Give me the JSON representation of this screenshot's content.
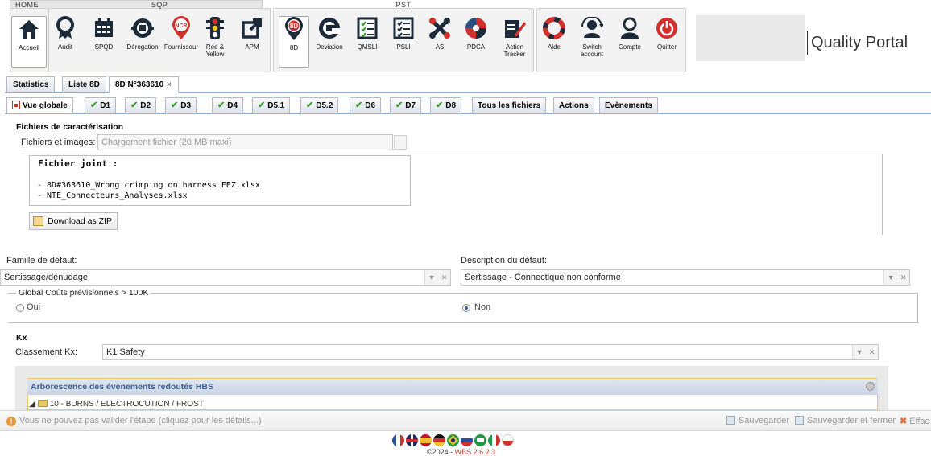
{
  "ribbon": {
    "groups": [
      {
        "title": "HOME"
      },
      {
        "title": "SQP"
      },
      {
        "title": "PST"
      },
      {
        "title": ""
      }
    ],
    "buttons": [
      {
        "label": "Accueil",
        "icon": "home-icon"
      },
      {
        "label": "Audit",
        "icon": "badge-icon"
      },
      {
        "label": "SPQD",
        "icon": "calendar-icon"
      },
      {
        "label": "Dérogation",
        "icon": "derogation-icon"
      },
      {
        "label": "Fournisseur",
        "icon": "ncr-icon"
      },
      {
        "label": "Red &\nYellow",
        "icon": "traffic-light-icon"
      },
      {
        "label": "APM",
        "icon": "external-arrow-icon"
      },
      {
        "label": "8D",
        "icon": "8d-icon"
      },
      {
        "label": "Deviation",
        "icon": "deviation-icon"
      },
      {
        "label": "QMSLI",
        "icon": "checklist-icon"
      },
      {
        "label": "PSLI",
        "icon": "checklist-icon"
      },
      {
        "label": "AS",
        "icon": "tools-icon"
      },
      {
        "label": "PDCA",
        "icon": "pdca-icon"
      },
      {
        "label": "Action\nTracker",
        "icon": "action-tracker-icon"
      },
      {
        "label": "Aide",
        "icon": "lifebuoy-icon"
      },
      {
        "label": "Switch\naccount",
        "icon": "switch-user-icon"
      },
      {
        "label": "Compte",
        "icon": "user-icon"
      },
      {
        "label": "Quitter",
        "icon": "power-icon"
      }
    ],
    "portal_title": "Quality Portal"
  },
  "top_tabs": [
    {
      "label": "Statistics"
    },
    {
      "label": "Liste 8D"
    },
    {
      "label": "8D N°363610"
    }
  ],
  "sub_tabs": [
    {
      "label": "Vue globale"
    },
    {
      "label": "D1"
    },
    {
      "label": "D2"
    },
    {
      "label": "D3"
    },
    {
      "label": "D4"
    },
    {
      "label": "D5.1"
    },
    {
      "label": "D5.2"
    },
    {
      "label": "D6"
    },
    {
      "label": "D7"
    },
    {
      "label": "D8"
    },
    {
      "label": "Tous les fichiers"
    },
    {
      "label": "Actions"
    },
    {
      "label": "Evènements"
    }
  ],
  "characterisation": {
    "heading": "Fichiers de caractérisation",
    "files_label": "Fichiers et images:",
    "files_placeholder": "Chargement fichier (20 MB maxi)",
    "attachment_title": "Fichier joint :",
    "attachments": [
      "- 8D#363610_Wrong crimping on harness FEZ.xlsx",
      "- NTE_Connecteurs_Analyses.xlsx"
    ],
    "download_label": "Download as ZIP"
  },
  "defect": {
    "family_label": "Famille de défaut:",
    "family_value": "Sertissage/dénudage",
    "description_label": "Description du défaut:",
    "description_value": "Sertissage - Connectique non conforme",
    "costs_legend": "Global Coûts prévisionnels > 100K",
    "option_yes": "Oui",
    "option_no": "Non",
    "selected": "Non"
  },
  "kx": {
    "heading": "Kx",
    "label": "Classement Kx:",
    "value": "K1 Safety"
  },
  "hbs": {
    "title": "Arborescence des évènements redoutés HBS",
    "first_node": "10 - BURNS / ELECTROCUTION / FROST"
  },
  "status_bar": {
    "message": "Vous ne pouvez pas valider l'étape (cliquez pour les détails...)",
    "save": "Sauvegarder",
    "save_close": "Sauvegarder et fermer",
    "cancel": "Effac"
  },
  "footer": {
    "copyright": "©2024 - ",
    "version": "WBS 2.6.2.3"
  },
  "colors": {
    "tab_border": "#8fb0d4",
    "check_green": "#3c9a2e",
    "icon_dark": "#1c2a3a",
    "icon_red": "#d0312d",
    "hbs_header_text": "#3a5f8f"
  }
}
